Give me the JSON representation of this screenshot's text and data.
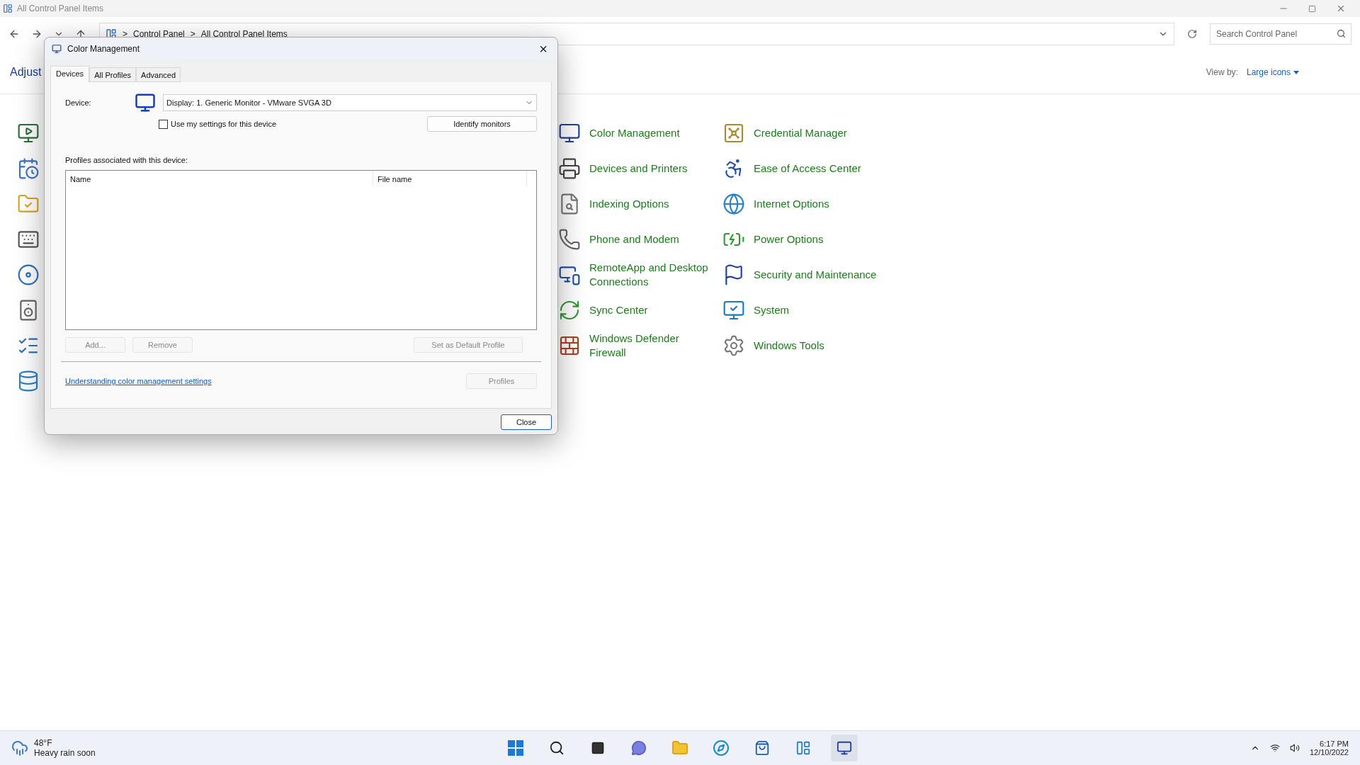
{
  "window": {
    "title": "All Control Panel Items"
  },
  "address_bar": {
    "crumbs": [
      "Control Panel",
      "All Control Panel Items"
    ],
    "separator": ">"
  },
  "search": {
    "placeholder": "Search Control Panel"
  },
  "heading": "Adjust",
  "view_by": {
    "label": "View by:",
    "value": "Large icons"
  },
  "items": [
    [
      {
        "label": "Color Management"
      },
      {
        "label": "Devices and Printers"
      },
      {
        "label": "Indexing Options"
      },
      {
        "label": "Phone and Modem"
      },
      {
        "label": "RemoteApp and Desktop Connections"
      },
      {
        "label": "Sync Center"
      },
      {
        "label": "Windows Defender Firewall"
      }
    ],
    [
      {
        "label": "Credential Manager"
      },
      {
        "label": "Ease of Access Center"
      },
      {
        "label": "Internet Options"
      },
      {
        "label": "Power Options"
      },
      {
        "label": "Security and Maintenance"
      },
      {
        "label": "System"
      },
      {
        "label": "Windows Tools"
      }
    ]
  ],
  "dialog": {
    "title": "Color Management",
    "close": "×",
    "tabs": [
      {
        "label": "Devices",
        "selected": true
      },
      {
        "label": "All Profiles",
        "selected": false
      },
      {
        "label": "Advanced",
        "selected": false
      }
    ],
    "device_label": "Device:",
    "device_value": "Display: 1. Generic Monitor - VMware SVGA 3D",
    "use_my_settings": {
      "label": "Use my settings for this device",
      "checked": false
    },
    "identify_button": "Identify monitors",
    "profiles_label": "Profiles associated with this device:",
    "table": {
      "columns": [
        "Name",
        "File name"
      ]
    },
    "actions": [
      {
        "label": "Add...",
        "disabled": true
      },
      {
        "label": "Remove",
        "disabled": true
      },
      {
        "label": "Set as Default Profile",
        "disabled": true
      }
    ],
    "link": "Understanding color management settings",
    "profiles_button": {
      "label": "Profiles",
      "disabled": true
    },
    "close_button": "Close"
  },
  "taskbar": {
    "temperature": "48°F",
    "forecast": "Heavy rain soon",
    "time": "6:17 PM",
    "date": "12/10/2022"
  }
}
